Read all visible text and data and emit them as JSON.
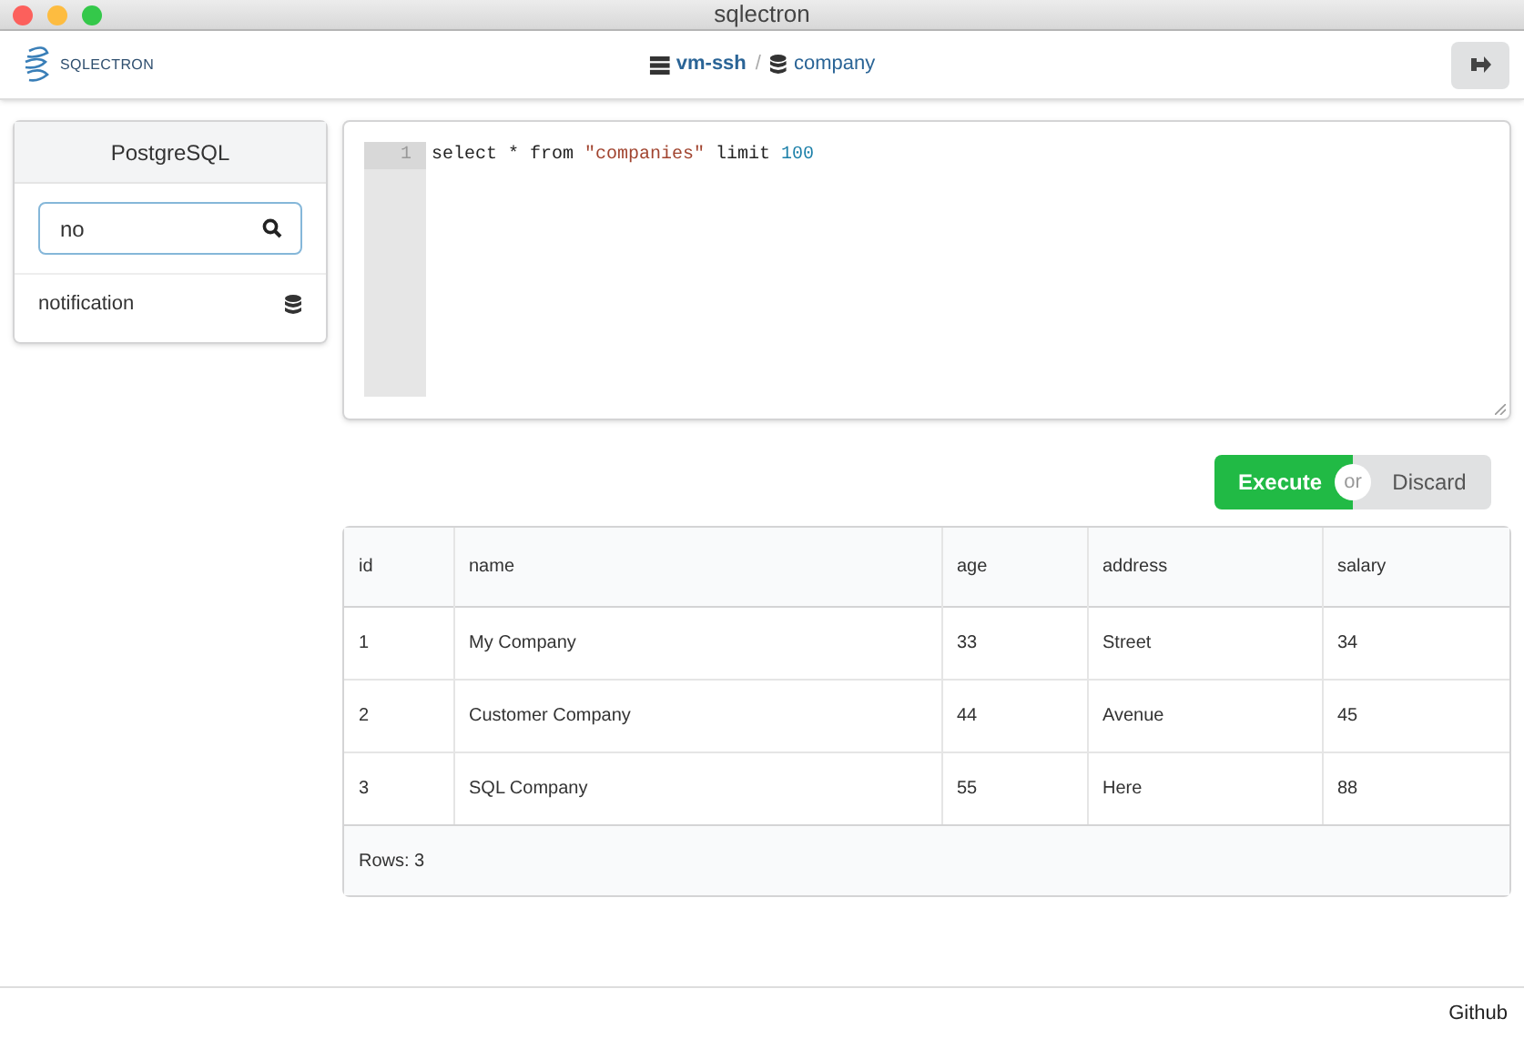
{
  "window": {
    "title": "sqlectron"
  },
  "header": {
    "logo_text": "SQLECTRON",
    "breadcrumb": [
      {
        "kind": "server",
        "label": "vm-ssh"
      },
      {
        "kind": "separator",
        "label": "/"
      },
      {
        "kind": "database",
        "label": "company"
      }
    ]
  },
  "sidebar": {
    "title": "PostgreSQL",
    "search": {
      "value": "no"
    },
    "items": [
      {
        "label": "notification"
      }
    ]
  },
  "editor": {
    "lines": [
      {
        "number": "1",
        "tokens": [
          {
            "kind": "plain",
            "text": "select * from "
          },
          {
            "kind": "string",
            "text": "\"companies\""
          },
          {
            "kind": "plain",
            "text": " limit "
          },
          {
            "kind": "number",
            "text": "100"
          }
        ]
      }
    ]
  },
  "actions": {
    "execute": "Execute",
    "or": "or",
    "discard": "Discard"
  },
  "table": {
    "columns": [
      "id",
      "name",
      "age",
      "address",
      "salary"
    ],
    "rows": [
      [
        "1",
        "My Company",
        "33",
        "Street",
        "34"
      ],
      [
        "2",
        "Customer Company",
        "44",
        "Avenue",
        "45"
      ],
      [
        "3",
        "SQL Company",
        "55",
        "Here",
        "88"
      ]
    ],
    "footer": "Rows: 3"
  },
  "footer": {
    "link": "Github"
  }
}
